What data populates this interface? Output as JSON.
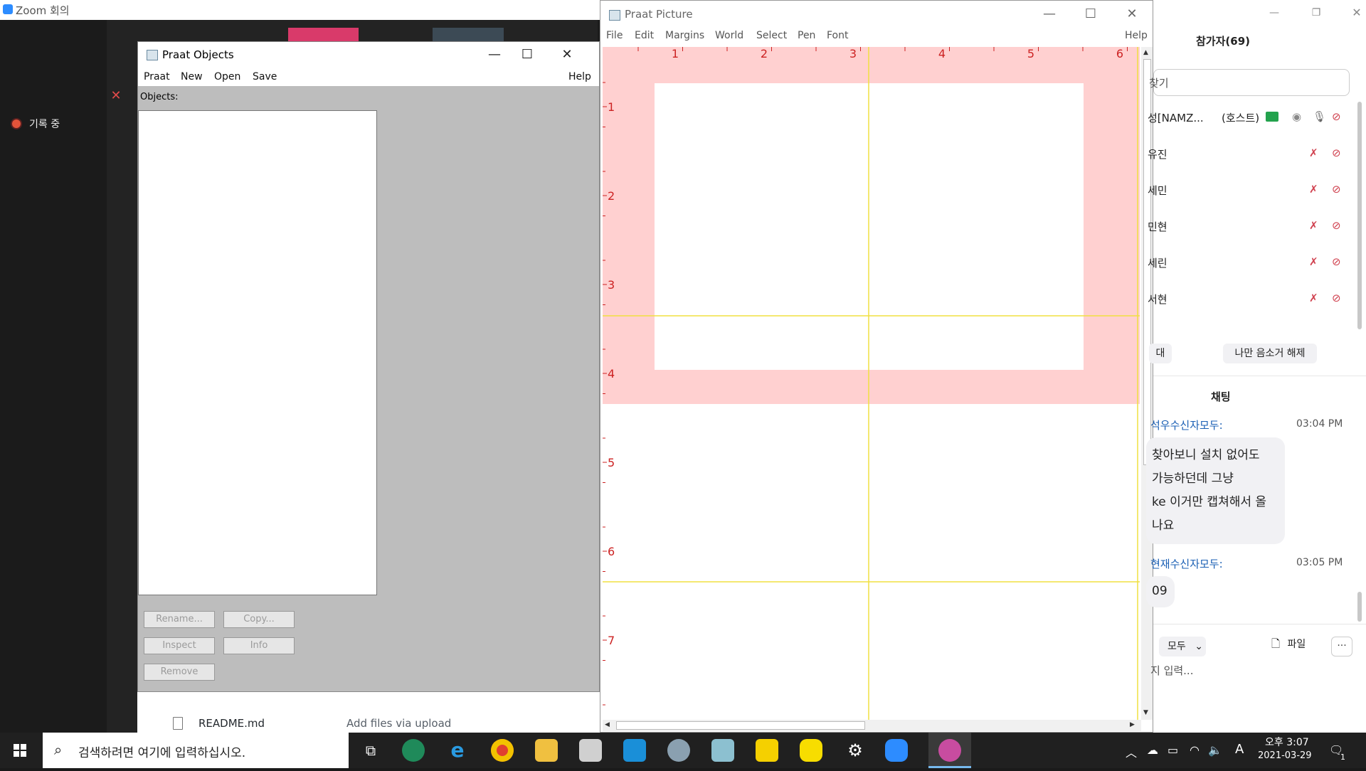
{
  "zoom": {
    "title": "Zoom 회의",
    "recording_label": "기록 중"
  },
  "github_bg": {
    "filename": "README.md",
    "commit_msg": "Add files via upload"
  },
  "praat_objects": {
    "title": "Praat Objects",
    "menus": [
      "Praat",
      "New",
      "Open",
      "Save"
    ],
    "help": "Help",
    "objects_label": "Objects:",
    "buttons": {
      "rename": "Rename...",
      "copy": "Copy...",
      "inspect": "Inspect",
      "info": "Info",
      "remove": "Remove"
    }
  },
  "praat_picture": {
    "title": "Praat Picture",
    "menus": [
      "File",
      "Edit",
      "Margins",
      "World",
      "Select",
      "Pen",
      "Font"
    ],
    "help": "Help",
    "top_ticks": [
      "1",
      "2",
      "3",
      "4",
      "5",
      "6"
    ],
    "left_ticks": [
      "1",
      "2",
      "3",
      "4",
      "5",
      "6",
      "7"
    ],
    "colors": {
      "viewport_fill": "#ffd0d0",
      "tick_color": "#cc2222",
      "guide_line": "#f0e040"
    }
  },
  "zoom_panel": {
    "participants_title": "참가자(69)",
    "search_placeholder": "찾기",
    "participants": [
      {
        "name": "성[NAMZ...",
        "tag": "(호스트)"
      },
      {
        "name": "유진"
      },
      {
        "name": "세민"
      },
      {
        "name": "민현"
      },
      {
        "name": "세린"
      },
      {
        "name": "서현"
      }
    ],
    "invite_label": "대",
    "unmute_label": "나만 음소거 해제",
    "chat_title": "채팅",
    "messages": [
      {
        "header": "석우수신자모두:",
        "time": "03:04 PM",
        "lines": [
          "찾아보니 설치 없어도",
          "가능하던데 그냥",
          "ke 이거만 캡쳐해서 올",
          "나요"
        ]
      },
      {
        "header": "현재수신자모두:",
        "time": "03:05 PM",
        "lines": [
          "09"
        ]
      }
    ],
    "to_label": "모두",
    "file_label": "파일",
    "more_label": "···",
    "input_placeholder": "지 입력..."
  },
  "taskbar": {
    "search_placeholder": "검색하려면 여기에 입력하십시오.",
    "clock_time": "오후 3:07",
    "clock_date": "2021-03-29",
    "ime": "A",
    "notification_count": "1"
  }
}
